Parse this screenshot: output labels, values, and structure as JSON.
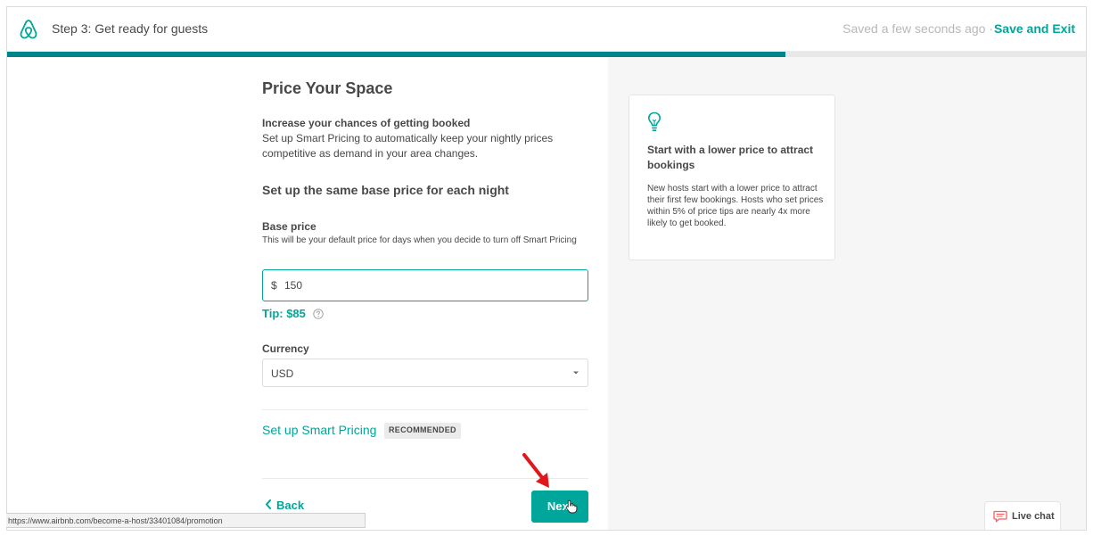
{
  "header": {
    "step_title": "Step 3: Get ready for guests",
    "saved_status": "Saved a few seconds ago ·",
    "save_exit_label": "Save and Exit"
  },
  "progress": {
    "fraction": 0.72
  },
  "form": {
    "title": "Price Your Space",
    "sub_heading": "Increase your chances of getting booked",
    "sub_text": "Set up Smart Pricing to automatically keep your nightly prices competitive as demand in your area changes.",
    "section_heading": "Set up the same base price for each night",
    "base_price_label": "Base price",
    "base_price_help": "This will be your default price for days when you decide to turn off Smart Pricing",
    "currency_symbol": "$",
    "base_price_value": "150",
    "tip_text": "Tip: $85",
    "currency_label": "Currency",
    "currency_value": "USD",
    "smart_pricing_link": "Set up Smart Pricing",
    "recommended_badge": "RECOMMENDED",
    "back_label": "Back",
    "next_label": "Next"
  },
  "tip_card": {
    "heading": "Start with a lower price to attract bookings",
    "body": "New hosts start with a lower price to attract their first few bookings. Hosts who set prices within 5% of price tips are nearly 4x more likely to get booked."
  },
  "live_chat": {
    "label": "Live chat"
  },
  "status_bar": {
    "url": "https://www.airbnb.com/become-a-host/33401084/promotion"
  },
  "colors": {
    "accent": "#00a699",
    "progress": "#008489",
    "arrow": "#e0171d"
  },
  "icons": [
    "airbnb-logo-icon",
    "help-circle-icon",
    "chevron-down-icon",
    "chevron-left-icon",
    "lightbulb-icon",
    "chat-bubble-icon",
    "red-arrow-annotation",
    "hand-cursor-icon"
  ]
}
